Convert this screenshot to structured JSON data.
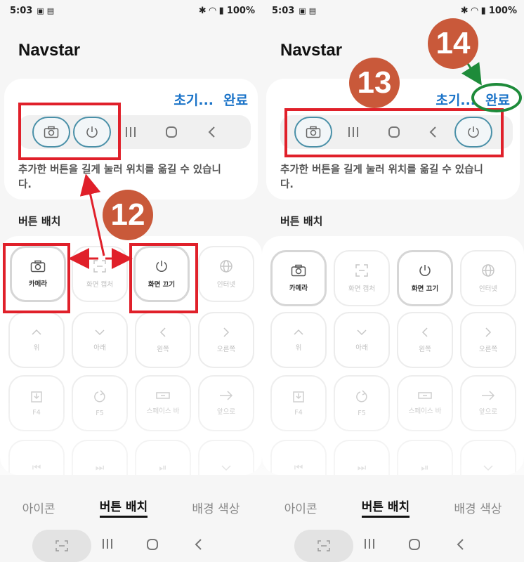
{
  "left": {
    "status": {
      "time": "5:03",
      "battery": "100%"
    },
    "title": "Navstar",
    "reset_label": "초기...",
    "done_label": "완료",
    "hint": "추가한 버튼을 길게 눌러 위치를 옮길 수 있습니다.",
    "section_label": "버튼 배치",
    "annotation": "12",
    "tiles": [
      {
        "label": "카메라"
      },
      {
        "label": "화면 캡처"
      },
      {
        "label": "화면 끄기"
      },
      {
        "label": "인터넷"
      },
      {
        "label": "위"
      },
      {
        "label": "아래"
      },
      {
        "label": "왼쪽"
      },
      {
        "label": "오른쪽"
      },
      {
        "label": "F4"
      },
      {
        "label": "F5"
      },
      {
        "label": "스페이스 바"
      },
      {
        "label": "앞으로"
      }
    ],
    "tabs": [
      "아이콘",
      "버튼 배치",
      "배경 색상"
    ]
  },
  "right": {
    "status": {
      "time": "5:03",
      "battery": "100%"
    },
    "title": "Navstar",
    "reset_label": "초기...",
    "done_label": "완료",
    "hint": "추가한 버튼을 길게 눌러 위치를 옮길 수 있습니다.",
    "section_label": "버튼 배치",
    "annotation_13": "13",
    "annotation_14": "14",
    "tiles": [
      {
        "label": "카메라"
      },
      {
        "label": "화면 캡처"
      },
      {
        "label": "화면 끄기"
      },
      {
        "label": "인터넷"
      },
      {
        "label": "위"
      },
      {
        "label": "아래"
      },
      {
        "label": "왼쪽"
      },
      {
        "label": "오른쪽"
      },
      {
        "label": "F4"
      },
      {
        "label": "F5"
      },
      {
        "label": "스페이스 바"
      },
      {
        "label": "앞으로"
      }
    ],
    "tabs": [
      "아이콘",
      "버튼 배치",
      "배경 색상"
    ]
  },
  "colors": {
    "accent_blue": "#1a73c8",
    "annotation_red": "#e0202a",
    "annotation_green": "#1e8b3a",
    "badge": "#c9593a",
    "button_ring": "#4a90a8"
  },
  "icons": [
    "camera-icon",
    "power-icon",
    "recents-icon",
    "home-icon",
    "back-icon",
    "screenshot-icon",
    "globe-icon",
    "chevron-up-icon",
    "chevron-down-icon",
    "chevron-left-icon",
    "chevron-right-icon",
    "f4-icon",
    "refresh-icon",
    "space-icon",
    "arrow-right-icon",
    "rewind-icon",
    "fast-forward-icon",
    "play-pause-icon"
  ]
}
